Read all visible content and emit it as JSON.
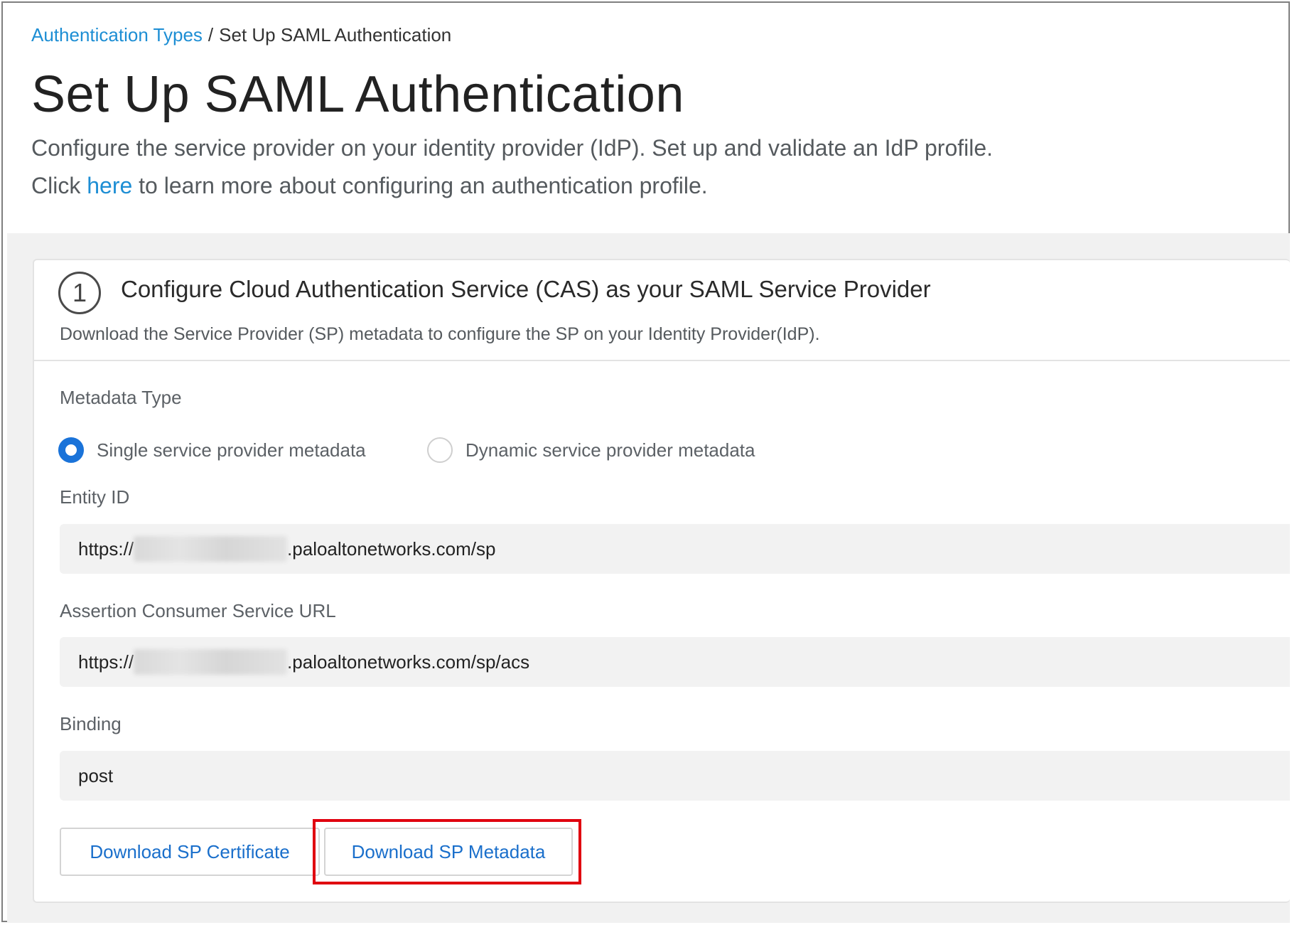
{
  "breadcrumb": {
    "parent": "Authentication Types",
    "separator": "/",
    "current": "Set Up SAML Authentication"
  },
  "page": {
    "title": "Set Up SAML Authentication",
    "description_line1": "Configure the service provider on your identity provider (IdP). Set up and validate an IdP profile.",
    "description_line2_prefix": "Click ",
    "description_line2_link": "here",
    "description_line2_suffix": " to learn more about configuring an authentication profile."
  },
  "step": {
    "number": "1",
    "title": "Configure Cloud Authentication Service (CAS) as your SAML Service Provider",
    "subtitle": "Download the Service Provider (SP) metadata to configure the SP on your Identity Provider(IdP)."
  },
  "metadata_type": {
    "label": "Metadata Type",
    "options": [
      {
        "label": "Single service provider metadata",
        "selected": true
      },
      {
        "label": "Dynamic service provider metadata",
        "selected": false
      }
    ]
  },
  "entity_id": {
    "label": "Entity ID",
    "prefix": "https://",
    "suffix": ".paloaltonetworks.com/sp"
  },
  "acs_url": {
    "label": "Assertion Consumer Service URL",
    "prefix": "https://",
    "suffix": ".paloaltonetworks.com/sp/acs"
  },
  "binding": {
    "label": "Binding",
    "value": "post"
  },
  "buttons": {
    "download_certificate": "Download SP Certificate",
    "download_metadata": "Download SP Metadata"
  },
  "colors": {
    "link": "#1d8ed4",
    "radio_selected": "#1a73d9",
    "button_text": "#1a6fcb",
    "highlight": "#e0000f"
  }
}
